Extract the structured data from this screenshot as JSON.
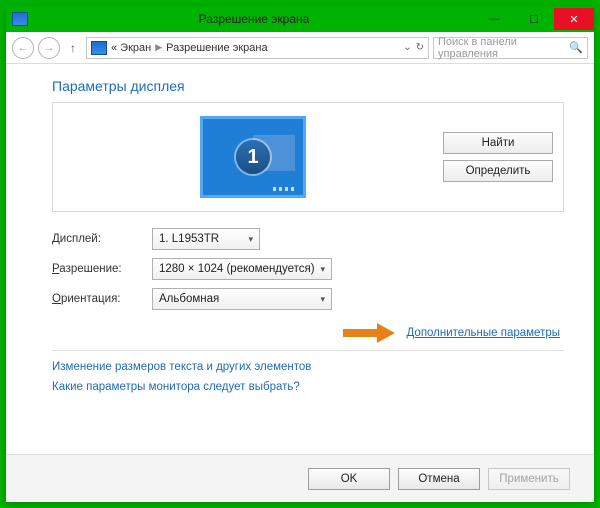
{
  "window": {
    "title": "Разрешение экрана"
  },
  "nav": {
    "bc_root": "« Экран",
    "bc_current": "Разрешение экрана",
    "search_placeholder": "Поиск в панели управления"
  },
  "page": {
    "heading": "Параметры дисплея",
    "find_btn": "Найти",
    "detect_btn": "Определить",
    "monitor_number": "1"
  },
  "form": {
    "display_label": "Дисплей:",
    "display_value": "1. L1953TR",
    "resolution_label": "Разрешение:",
    "resolution_value": "1280 × 1024 (рекомендуется)",
    "orientation_label": "Ориентация:",
    "orientation_value": "Альбомная"
  },
  "links": {
    "advanced": "Дополнительные параметры",
    "text_size": "Изменение размеров текста и других элементов",
    "which_settings": "Какие параметры монитора следует выбрать?"
  },
  "footer": {
    "ok": "OK",
    "cancel": "Отмена",
    "apply": "Применить"
  }
}
